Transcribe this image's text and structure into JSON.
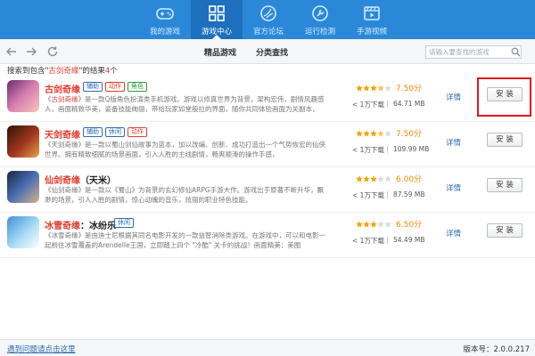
{
  "nav": [
    {
      "label": "我的游戏",
      "icon": "gamepad-icon",
      "active": false
    },
    {
      "label": "游戏中心",
      "icon": "grid-icon",
      "active": true
    },
    {
      "label": "官方论坛",
      "icon": "forum-icon",
      "active": false
    },
    {
      "label": "运行检测",
      "icon": "wrench-icon",
      "active": false
    },
    {
      "label": "手游视频",
      "icon": "video-icon",
      "active": false
    }
  ],
  "toolbar": {
    "back_icon": "arrow-left-icon",
    "forward_icon": "arrow-right-icon",
    "refresh_icon": "refresh-icon",
    "tabs": [
      "精品游戏",
      "分类查找"
    ],
    "search_placeholder": "请输入要查找的游戏"
  },
  "summary": {
    "prefix": "搜索到包含\"",
    "keyword": "古剑奇缘",
    "mid": "\"的结果",
    "count": "4",
    "suffix": "个"
  },
  "games": [
    {
      "title_hl": "古剑奇缘",
      "title_rest": "",
      "tags": [
        {
          "text": "辅助",
          "color": "#2b6cb3"
        },
        {
          "text": "动作",
          "color": "#e23b2e"
        },
        {
          "text": "角色",
          "color": "#2e9e3a"
        }
      ],
      "desc_pre": "《",
      "desc_hl": "古剑奇缘",
      "desc_post": "》是一款Q版角色扮演类手机游戏。游戏以修真世界为背景，架构宏伟，剧情风趣感人，画面精致华美，姿备技能绚丽，带给玩家如堂般拉的界面，随你共同体验画面为关副本，",
      "stars": 3.5,
      "score": "7.50分",
      "downloads": "< 1万下载",
      "size": "64.71 MB",
      "detail": "详情",
      "install": "安  装"
    },
    {
      "title_hl": "天剑奇缘",
      "title_rest": "",
      "tags": [
        {
          "text": "辅助",
          "color": "#2b6cb3"
        },
        {
          "text": "休闲",
          "color": "#2b6cb3"
        },
        {
          "text": "动作",
          "color": "#e23b2e"
        }
      ],
      "desc_pre": "《天剑奇缘》是一款以蜀山剑仙故事为蓝本，加以改编、创新、成功打造出一个气势恢宏的仙侠世界。拥有精致细腻的场景画面，引入人胜的主线剧情，畅爽顺滑的操作手感，",
      "desc_hl": "",
      "desc_post": "",
      "stars": 3.5,
      "score": "7.50分",
      "downloads": "< 1万下载",
      "size": "109.99 MB",
      "detail": "详情",
      "install": "安  装"
    },
    {
      "title_hl": "仙剑奇缘",
      "title_rest": "（天米）",
      "tags": [],
      "desc_pre": "《仙剑奇缘》是一款以《蜀山》为背景的玄幻修仙ARPG手游大作。游戏出于原著不断升华，飘渺的场景，引人入胜的剧情，惊心动魄的音乐，炫丽的职业特色技能。",
      "desc_hl": "",
      "desc_post": "",
      "stars": 3,
      "score": "6.00分",
      "downloads": "< 1万下载",
      "size": "87.59 MB",
      "detail": "详情",
      "install": "安  装"
    },
    {
      "title_hl": "冰雪奇缘",
      "title_rest": "：冰纷乐",
      "tags": [
        {
          "text": "休闲",
          "color": "#2b6cb3"
        }
      ],
      "desc_pre": "《冰雪奇缘》是由迪士尼根据其同名电影开发的一款益智消除类游戏。在游戏中，可以和电影一起前往冰雪覆盖的Arendelle王国，立即踏上四个 \"冷酷\" 关卡的挑战！画面精美：美图",
      "desc_hl": "",
      "desc_post": "",
      "stars": 3,
      "score": "6.50分",
      "downloads": "< 1万下载",
      "size": "54.49 MB",
      "detail": "详情",
      "install": "安  装"
    }
  ],
  "footer": {
    "help_link": "遇到问题请点击这里",
    "version": "版本号：2.0.0.217"
  },
  "colors": {
    "topbar": "#2b88d9",
    "active_tab": "#1e6fbd",
    "highlight": "#e23b2e",
    "score": "#f08c00",
    "callout": "#e1141c"
  }
}
